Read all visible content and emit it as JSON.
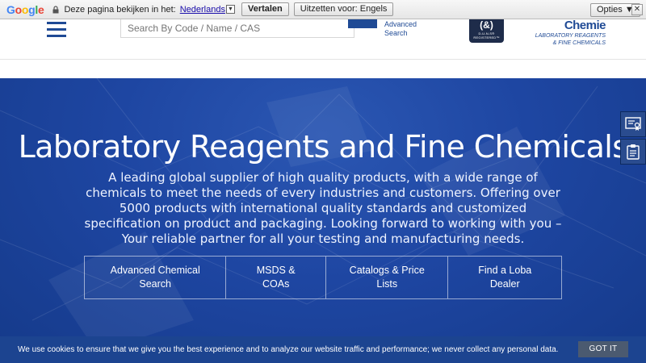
{
  "translate_bar": {
    "logo": [
      "G",
      "o",
      "o",
      "g",
      "l",
      "e"
    ],
    "prompt": "Deze pagina bekijken in het:",
    "language": "Nederlands",
    "translate_label": "Vertalen",
    "turn_off_label": "Uitzetten voor: Engels",
    "options_label": "Opties ▼",
    "close_label": "✕"
  },
  "header": {
    "search_placeholder": "Search By Code / Name / CAS",
    "advanced_search_line1": "Advanced",
    "advanced_search_line2": "Search",
    "duns_label": "D-U-N-S® REGISTERED™",
    "brand_name": "Chemie",
    "brand_tagline_line1": "LABORATORY REAGENTS",
    "brand_tagline_line2": "& FINE CHEMICALS"
  },
  "hero": {
    "title": "Laboratory Reagents and Fine Chemicals",
    "description": "A leading global supplier of high quality products, with a wide range of chemicals to meet the needs of every industries and customers. Offering over 5000 products with international quality standards and customized specification on product and packaging. Looking forward to working with you – Your reliable partner for all your testing and manufacturing needs.",
    "actions": [
      {
        "line1": "Advanced Chemical",
        "line2": "Search"
      },
      {
        "line1": "MSDS &",
        "line2": "COAs"
      },
      {
        "line1": "Catalogs & Price",
        "line2": "Lists"
      },
      {
        "line1": "Find a Loba",
        "line2": "Dealer"
      }
    ]
  },
  "cookie": {
    "message": "We use cookies to ensure that we give you the best experience and to analyze our website traffic and performance; we never collect any personal data.",
    "accept_label": "GOT IT"
  },
  "colors": {
    "brand_blue": "#1f4a95",
    "hero_blue": "#1e46a2",
    "cookie_bar": "#1c4490",
    "cookie_button": "#4b5a70"
  }
}
